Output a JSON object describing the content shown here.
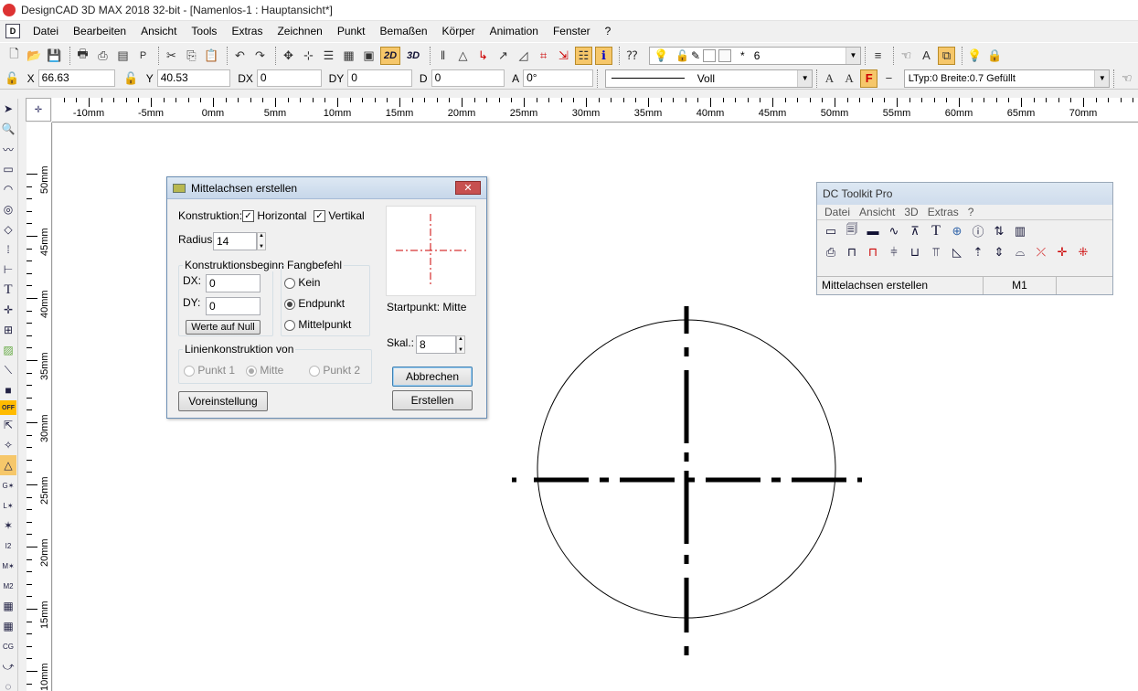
{
  "window": {
    "title": "DesignCAD 3D MAX 2018 32-bit - [Namenlos-1 : Hauptansicht*]"
  },
  "menu": [
    "Datei",
    "Bearbeiten",
    "Ansicht",
    "Tools",
    "Extras",
    "Zeichnen",
    "Punkt",
    "Bemaßen",
    "Körper",
    "Animation",
    "Fenster",
    "?"
  ],
  "toolbar": {
    "btn_2d": "2D",
    "btn_3d": "3D",
    "layer_star": "*",
    "layer_value": "6"
  },
  "coords": {
    "x_label": "X",
    "x_value": "66.63",
    "y_label": "Y",
    "y_value": "40.53",
    "dx_label": "DX",
    "dx_value": "0",
    "dy_label": "DY",
    "dy_value": "0",
    "d_label": "D",
    "d_value": "0",
    "a_label": "A",
    "a_value": "0°"
  },
  "line_style": {
    "name": "Voll",
    "ltyp": "LTyp:0  Breite:0.7  Gefüllt",
    "font_a1": "A",
    "font_a2": "A",
    "font_f": "F"
  },
  "ruler": {
    "h_labels": [
      "-10mm",
      "-5mm",
      "0mm",
      "5mm",
      "10mm",
      "15mm",
      "20mm",
      "25mm",
      "30mm",
      "35mm",
      "40mm",
      "45mm",
      "50mm",
      "55mm",
      "60mm",
      "65mm",
      "70mm"
    ],
    "v_labels": [
      "50mm",
      "45mm",
      "40mm",
      "35mm",
      "30mm",
      "25mm",
      "20mm",
      "15mm",
      "10mm"
    ]
  },
  "dialog": {
    "title": "Mittelachsen erstellen",
    "konstruktion_label": "Konstruktion:",
    "horizontal_label": "Horizontal",
    "horizontal_checked": true,
    "vertikal_label": "Vertikal",
    "vertikal_checked": true,
    "radius_label": "Radius:",
    "radius_value": "14",
    "konstruktionsbeginn_label": "Konstruktionsbeginn",
    "dx_label": "DX:",
    "dx_value": "0",
    "dy_label": "DY:",
    "dy_value": "0",
    "werte_button": "Werte auf Null",
    "fangbefehl_label": "Fangbefehl",
    "fang_options": [
      "Kein",
      "Endpunkt",
      "Mittelpunkt"
    ],
    "fang_selected": "Endpunkt",
    "startpunkt_label": "Startpunkt: Mitte",
    "skal_label": "Skal.:",
    "skal_value": "8",
    "linien_label": "Linienkonstruktion von",
    "linien_options": [
      "Punkt 1",
      "Mitte",
      "Punkt 2"
    ],
    "linien_selected": "Mitte",
    "abbrechen_button": "Abbrechen",
    "voreinstellung_button": "Voreinstellung",
    "erstellen_button": "Erstellen"
  },
  "toolkit": {
    "title": "DC Toolkit Pro",
    "menu": [
      "Datei",
      "Ansicht",
      "3D",
      "Extras",
      "?"
    ],
    "status_command": "Mittelachsen erstellen",
    "status_mode": "M1"
  },
  "colors": {
    "accent_pressed": "#f6c76a",
    "centerline_red": "#cc0000"
  }
}
